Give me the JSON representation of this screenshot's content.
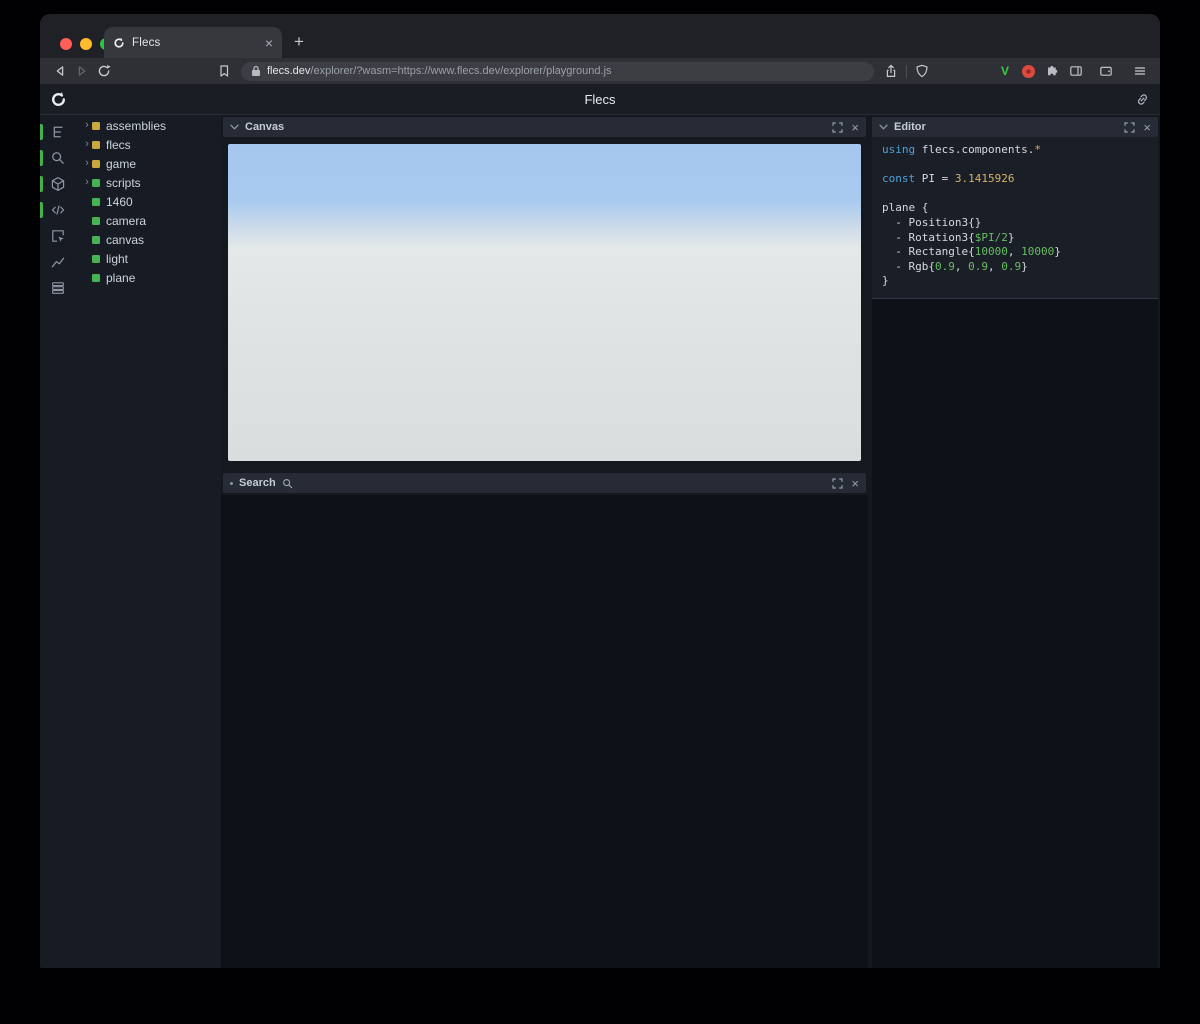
{
  "icons": {
    "close_glyph": "×",
    "new_tab_glyph": "+",
    "expander_glyph": "›"
  },
  "browser": {
    "tab_title": "Flecs",
    "url_host": "flecs.dev",
    "url_rest": "/explorer/?wasm=https://www.flecs.dev/explorer/playground.js",
    "extension_v": "V"
  },
  "app": {
    "title": "Flecs"
  },
  "tree": {
    "items": [
      {
        "label": "assemblies",
        "expandable": true,
        "kind": "module",
        "color": "#c9a83f"
      },
      {
        "label": "flecs",
        "expandable": true,
        "kind": "module",
        "color": "#c9a83f"
      },
      {
        "label": "game",
        "expandable": true,
        "kind": "module",
        "color": "#c9a83f"
      },
      {
        "label": "scripts",
        "expandable": true,
        "kind": "entity",
        "color": "#47b353"
      },
      {
        "label": "1460",
        "expandable": false,
        "kind": "entity",
        "color": "#47b353"
      },
      {
        "label": "camera",
        "expandable": false,
        "kind": "entity",
        "color": "#47b353"
      },
      {
        "label": "canvas",
        "expandable": false,
        "kind": "entity",
        "color": "#47b353"
      },
      {
        "label": "light",
        "expandable": false,
        "kind": "entity",
        "color": "#47b353"
      },
      {
        "label": "plane",
        "expandable": false,
        "kind": "entity",
        "color": "#47b353"
      }
    ]
  },
  "panels": {
    "canvas": {
      "title": "Canvas"
    },
    "search": {
      "title": "Search"
    },
    "editor": {
      "title": "Editor"
    }
  },
  "editor": {
    "colors": {
      "kw": "#4fa1d8",
      "num": "#d8b168",
      "val": "#67bd63",
      "def": "#d6d9de"
    },
    "lines": [
      [
        [
          "kw",
          "using "
        ],
        [
          "def",
          "flecs.components."
        ],
        [
          "num",
          "*"
        ]
      ],
      [],
      [
        [
          "kw",
          "const "
        ],
        [
          "def",
          "PI = "
        ],
        [
          "num",
          "3.1415926"
        ]
      ],
      [],
      [
        [
          "def",
          "plane {"
        ]
      ],
      [
        [
          "def",
          "  - Position3{}"
        ]
      ],
      [
        [
          "def",
          "  - Rotation3{"
        ],
        [
          "val",
          "$PI/2"
        ],
        [
          "def",
          "}"
        ]
      ],
      [
        [
          "def",
          "  - Rectangle{"
        ],
        [
          "val",
          "10000"
        ],
        [
          "def",
          ", "
        ],
        [
          "val",
          "10000"
        ],
        [
          "def",
          "}"
        ]
      ],
      [
        [
          "def",
          "  - Rgb{"
        ],
        [
          "val",
          "0.9"
        ],
        [
          "def",
          ", "
        ],
        [
          "val",
          "0.9"
        ],
        [
          "def",
          ", "
        ],
        [
          "val",
          "0.9"
        ],
        [
          "def",
          "}"
        ]
      ],
      [
        [
          "def",
          "}"
        ]
      ]
    ]
  },
  "colors": {
    "accent_green": "#43b04c",
    "module_yellow": "#c9a83f",
    "entity_green": "#47b353",
    "canvas_sky": "#a5c7ee",
    "canvas_ground": "#dce2e2"
  }
}
